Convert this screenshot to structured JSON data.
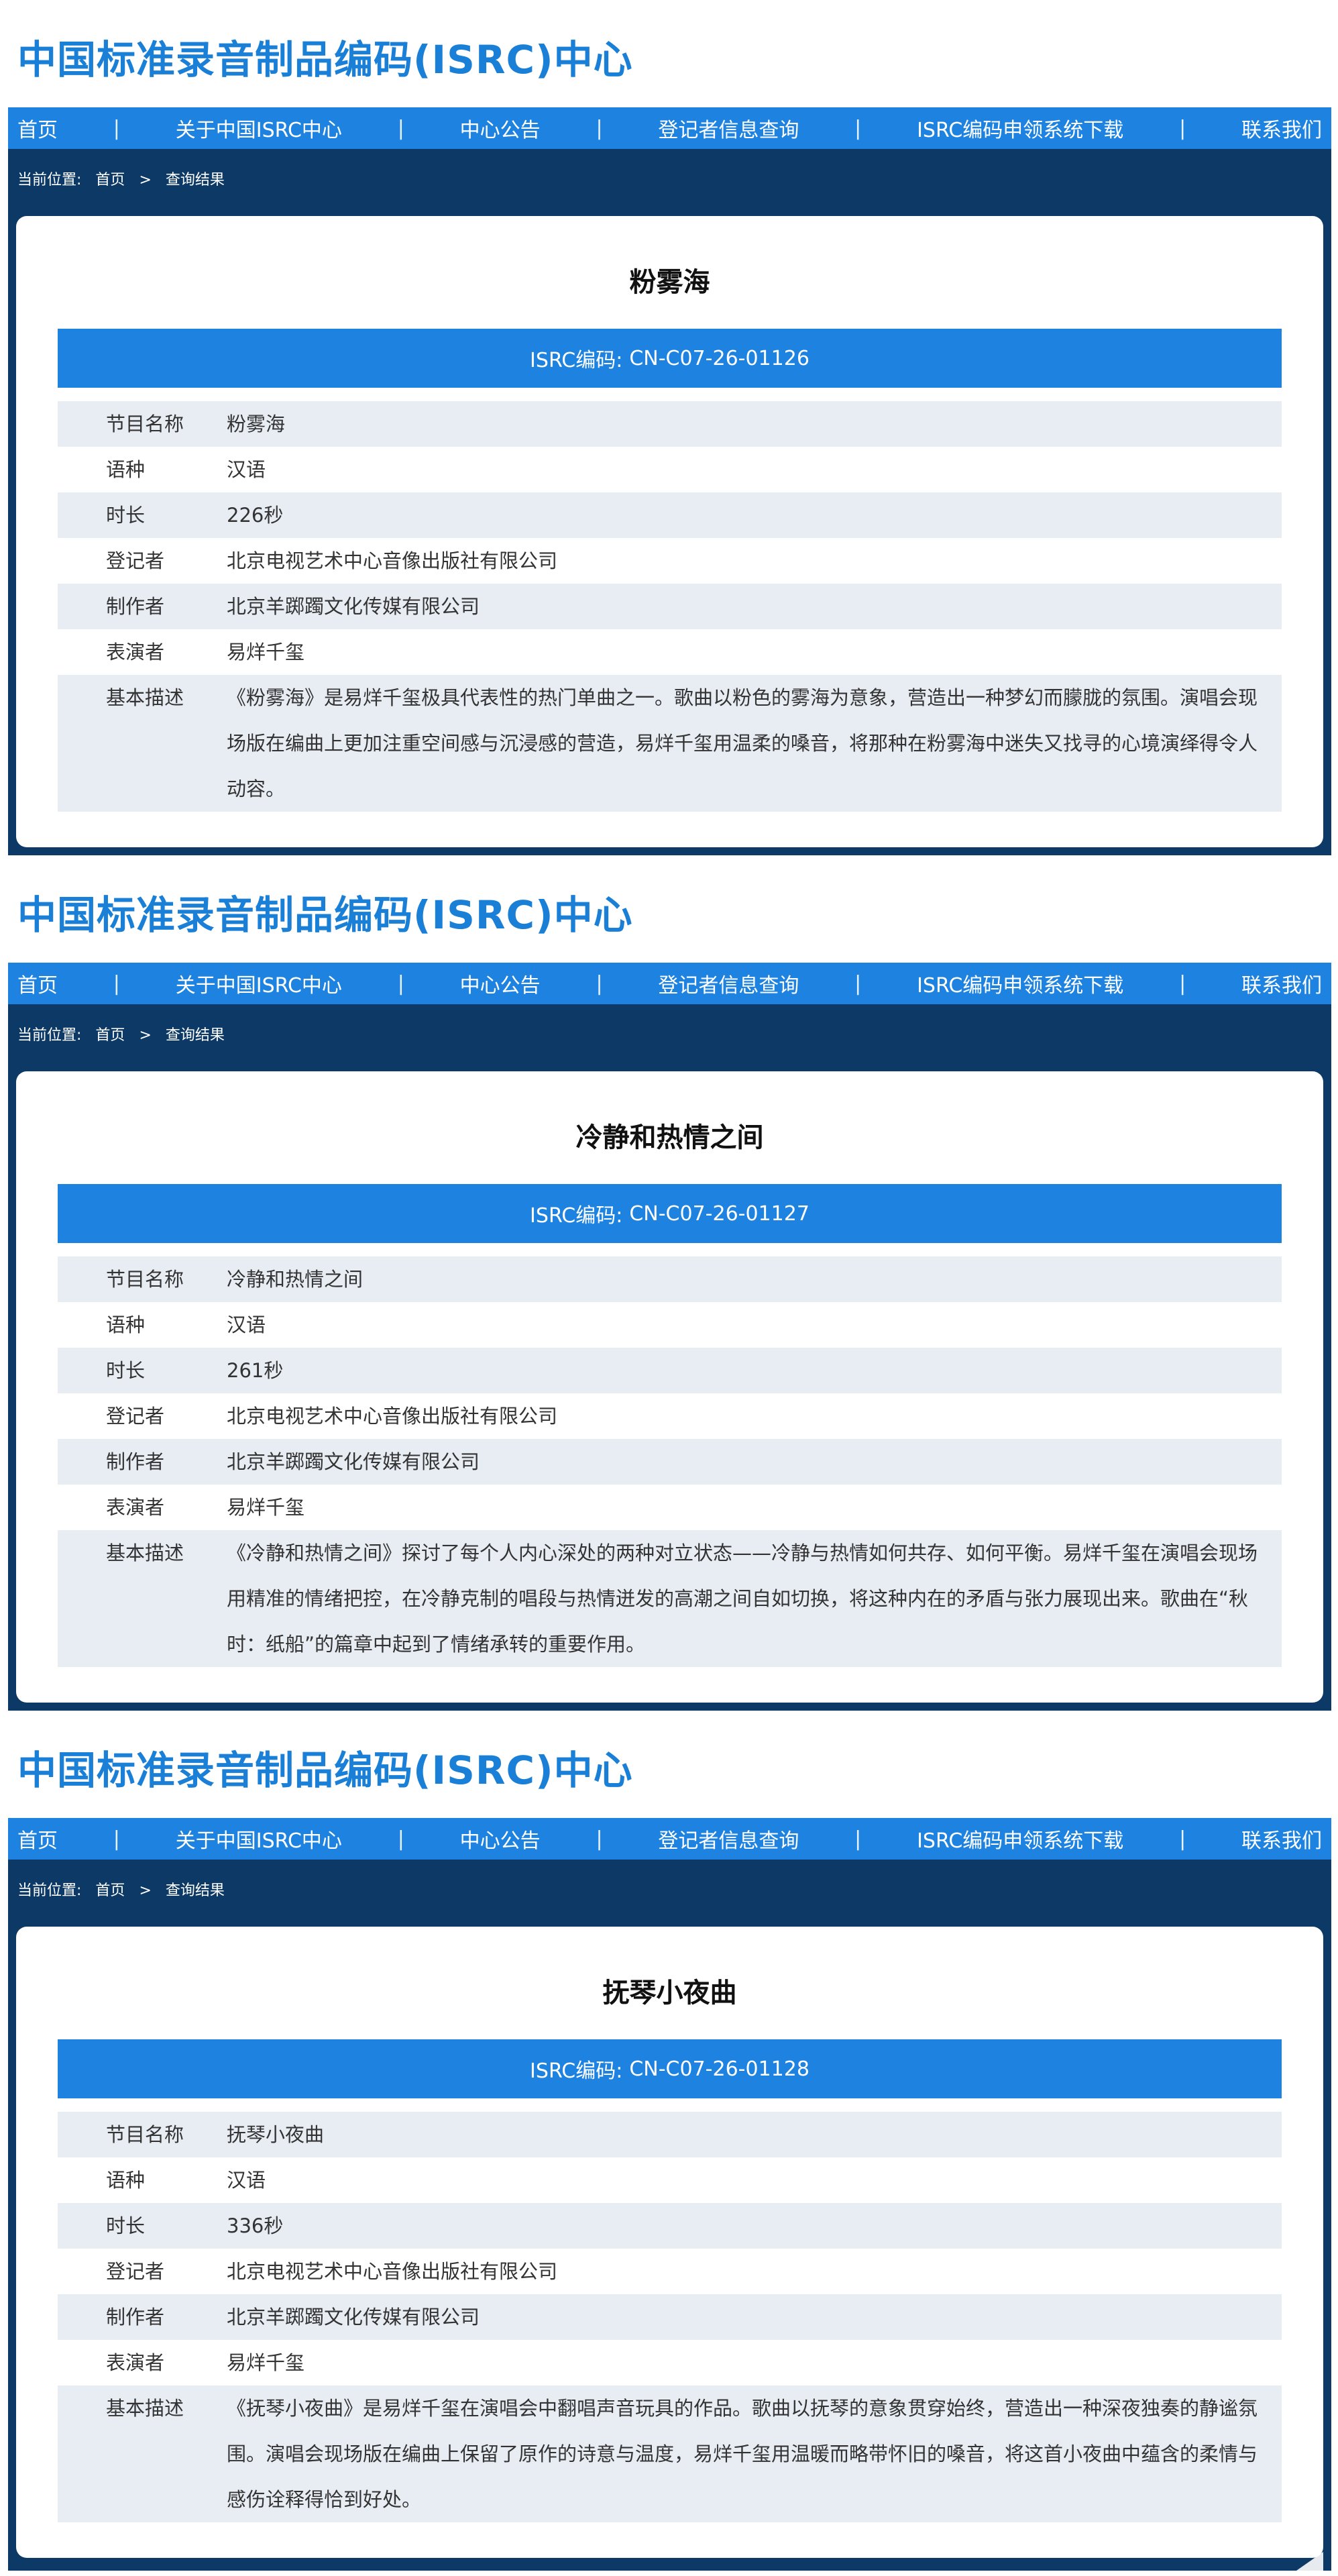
{
  "panels": [
    {
      "site_title": "中国标准录音制品编码(ISRC)中心",
      "nav": [
        "首页",
        "关于中国ISRC中心",
        "中心公告",
        "登记者信息查询",
        "ISRC编码申领系统下载",
        "联系我们"
      ],
      "nav_separator": "|",
      "breadcrumb": {
        "label": "当前位置:",
        "home": "首页",
        "sep": ">",
        "current": "查询结果"
      },
      "song_title": "粉雾海",
      "isrc_label": "ISRC编码:",
      "isrc_code": "CN-C07-26-01126",
      "rows": [
        {
          "key": "节目名称",
          "value": "粉雾海"
        },
        {
          "key": "语种",
          "value": "汉语"
        },
        {
          "key": "时长",
          "value": "226秒"
        },
        {
          "key": "登记者",
          "value": "北京电视艺术中心音像出版社有限公司"
        },
        {
          "key": "制作者",
          "value": "北京羊踯躅文化传媒有限公司"
        },
        {
          "key": "表演者",
          "value": "易烊千玺"
        },
        {
          "key": "基本描述",
          "value": "《粉雾海》是易烊千玺极具代表性的热门单曲之一。歌曲以粉色的雾海为意象，营造出一种梦幻而朦胧的氛围。演唱会现场版在编曲上更加注重空间感与沉浸感的营造，易烊千玺用温柔的嗓音，将那种在粉雾海中迷失又找寻的心境演绎得令人动容。"
        }
      ]
    },
    {
      "site_title": "中国标准录音制品编码(ISRC)中心",
      "nav": [
        "首页",
        "关于中国ISRC中心",
        "中心公告",
        "登记者信息查询",
        "ISRC编码申领系统下载",
        "联系我们"
      ],
      "nav_separator": "|",
      "breadcrumb": {
        "label": "当前位置:",
        "home": "首页",
        "sep": ">",
        "current": "查询结果"
      },
      "song_title": "冷静和热情之间",
      "isrc_label": "ISRC编码:",
      "isrc_code": "CN-C07-26-01127",
      "rows": [
        {
          "key": "节目名称",
          "value": "冷静和热情之间"
        },
        {
          "key": "语种",
          "value": "汉语"
        },
        {
          "key": "时长",
          "value": "261秒"
        },
        {
          "key": "登记者",
          "value": "北京电视艺术中心音像出版社有限公司"
        },
        {
          "key": "制作者",
          "value": "北京羊踯躅文化传媒有限公司"
        },
        {
          "key": "表演者",
          "value": "易烊千玺"
        },
        {
          "key": "基本描述",
          "value": "《冷静和热情之间》探讨了每个人内心深处的两种对立状态——冷静与热情如何共存、如何平衡。易烊千玺在演唱会现场用精准的情绪把控，在冷静克制的唱段与热情迸发的高潮之间自如切换，将这种内在的矛盾与张力展现出来。歌曲在“秋时：纸船”的篇章中起到了情绪承转的重要作用。"
        }
      ]
    },
    {
      "site_title": "中国标准录音制品编码(ISRC)中心",
      "nav": [
        "首页",
        "关于中国ISRC中心",
        "中心公告",
        "登记者信息查询",
        "ISRC编码申领系统下载",
        "联系我们"
      ],
      "nav_separator": "|",
      "breadcrumb": {
        "label": "当前位置:",
        "home": "首页",
        "sep": ">",
        "current": "查询结果"
      },
      "song_title": "抚琴小夜曲",
      "isrc_label": "ISRC编码:",
      "isrc_code": "CN-C07-26-01128",
      "rows": [
        {
          "key": "节目名称",
          "value": "抚琴小夜曲"
        },
        {
          "key": "语种",
          "value": "汉语"
        },
        {
          "key": "时长",
          "value": "336秒"
        },
        {
          "key": "登记者",
          "value": "北京电视艺术中心音像出版社有限公司"
        },
        {
          "key": "制作者",
          "value": "北京羊踯躅文化传媒有限公司"
        },
        {
          "key": "表演者",
          "value": "易烊千玺"
        },
        {
          "key": "基本描述",
          "value": "《抚琴小夜曲》是易烊千玺在演唱会中翻唱声音玩具的作品。歌曲以抚琴的意象贯穿始终，营造出一种深夜独奏的静谧氛围。演唱会现场版在编曲上保留了原作的诗意与温度，易烊千玺用温暖而略带怀旧的嗓音，将这首小夜曲中蕴含的柔情与感伤诠释得恰到好处。"
        }
      ]
    }
  ],
  "colors": {
    "title_blue": "#1a7fd6",
    "nav_blue": "#1e83e0",
    "dark_navy": "#0c3966",
    "row_shade": "#e8edf4"
  },
  "icons": {
    "corner": "folded-page-icon"
  }
}
